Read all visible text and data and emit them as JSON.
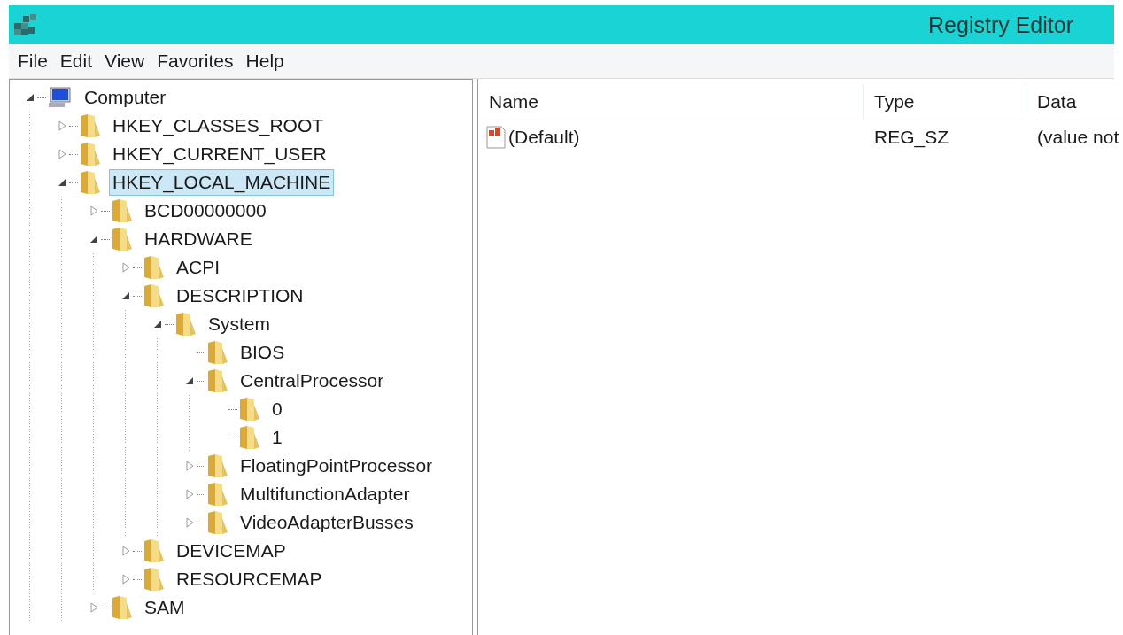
{
  "window": {
    "title": "Registry Editor"
  },
  "menu": [
    "File",
    "Edit",
    "View",
    "Favorites",
    "Help"
  ],
  "tree": [
    {
      "label": "Computer",
      "kind": "computer",
      "expandable": true,
      "expanded": true,
      "selected": false,
      "children": [
        {
          "label": "HKEY_CLASSES_ROOT",
          "kind": "folder",
          "expandable": true,
          "expanded": false,
          "selected": false
        },
        {
          "label": "HKEY_CURRENT_USER",
          "kind": "folder",
          "expandable": true,
          "expanded": false,
          "selected": false
        },
        {
          "label": "HKEY_LOCAL_MACHINE",
          "kind": "folder",
          "expandable": true,
          "expanded": true,
          "selected": true,
          "children": [
            {
              "label": "BCD00000000",
              "kind": "folder",
              "expandable": true,
              "expanded": false,
              "selected": false
            },
            {
              "label": "HARDWARE",
              "kind": "folder",
              "expandable": true,
              "expanded": true,
              "selected": false,
              "children": [
                {
                  "label": "ACPI",
                  "kind": "folder",
                  "expandable": true,
                  "expanded": false,
                  "selected": false
                },
                {
                  "label": "DESCRIPTION",
                  "kind": "folder",
                  "expandable": true,
                  "expanded": true,
                  "selected": false,
                  "children": [
                    {
                      "label": "System",
                      "kind": "folder",
                      "expandable": true,
                      "expanded": true,
                      "selected": false,
                      "children": [
                        {
                          "label": "BIOS",
                          "kind": "folder",
                          "expandable": false,
                          "expanded": false,
                          "selected": false
                        },
                        {
                          "label": "CentralProcessor",
                          "kind": "folder",
                          "expandable": true,
                          "expanded": true,
                          "selected": false,
                          "children": [
                            {
                              "label": "0",
                              "kind": "folder",
                              "expandable": false,
                              "expanded": false,
                              "selected": false
                            },
                            {
                              "label": "1",
                              "kind": "folder",
                              "expandable": false,
                              "expanded": false,
                              "selected": false
                            }
                          ]
                        },
                        {
                          "label": "FloatingPointProcessor",
                          "kind": "folder",
                          "expandable": true,
                          "expanded": false,
                          "selected": false
                        },
                        {
                          "label": "MultifunctionAdapter",
                          "kind": "folder",
                          "expandable": true,
                          "expanded": false,
                          "selected": false
                        },
                        {
                          "label": "VideoAdapterBusses",
                          "kind": "folder",
                          "expandable": true,
                          "expanded": false,
                          "selected": false
                        }
                      ]
                    }
                  ]
                },
                {
                  "label": "DEVICEMAP",
                  "kind": "folder",
                  "expandable": true,
                  "expanded": false,
                  "selected": false
                },
                {
                  "label": "RESOURCEMAP",
                  "kind": "folder",
                  "expandable": true,
                  "expanded": false,
                  "selected": false
                }
              ]
            },
            {
              "label": "SAM",
              "kind": "folder",
              "expandable": true,
              "expanded": false,
              "selected": false
            }
          ]
        }
      ]
    }
  ],
  "values": {
    "columns": [
      "Name",
      "Type",
      "Data"
    ],
    "rows": [
      {
        "name": "(Default)",
        "type": "REG_SZ",
        "data": "(value not"
      }
    ]
  }
}
